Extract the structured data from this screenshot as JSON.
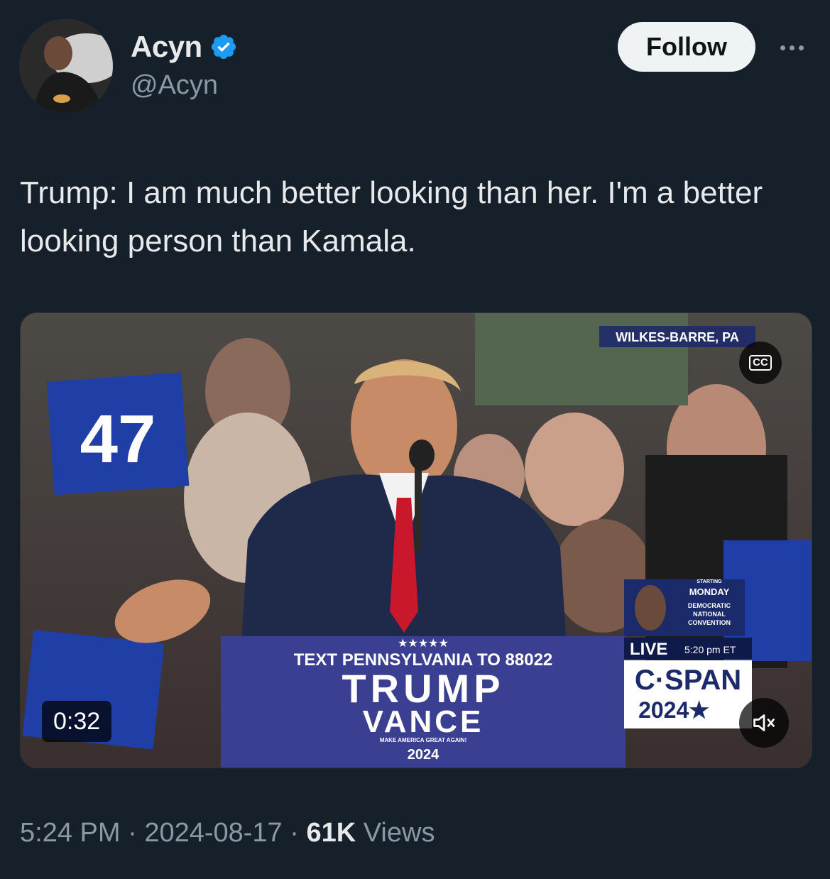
{
  "author": {
    "display_name": "Acyn",
    "handle": "@Acyn",
    "verified": true,
    "verified_color": "#1d9bf0"
  },
  "follow_label": "Follow",
  "more_icon": "more-horizontal-icon",
  "tweet_text": "Trump: I am much better looking than her. I'm a better looking person than Kamala.",
  "video": {
    "duration": "0:32",
    "cc_label": "CC",
    "location_chyron": "WILKES-BARRE, PA",
    "podium_text": "TEXT PENNSYLVANIA TO 88022",
    "podium_title": "TRUMP",
    "podium_subtitle": "VANCE",
    "podium_slogan": "MAKE AMERICA GREAT AGAIN!",
    "podium_year": "2024",
    "sign_number": "47",
    "live_label": "LIVE",
    "live_time": "5:20 pm ET",
    "network": "C·SPAN",
    "network_year": "2024★",
    "promo_line1": "STARTING",
    "promo_line2": "MONDAY",
    "promo_line3": "DEMOCRATIC",
    "promo_line4": "NATIONAL",
    "promo_line5": "CONVENTION"
  },
  "meta": {
    "time": "5:24 PM",
    "date": "2024-08-17",
    "views_count": "61K",
    "views_label": "Views",
    "separator": "·"
  }
}
